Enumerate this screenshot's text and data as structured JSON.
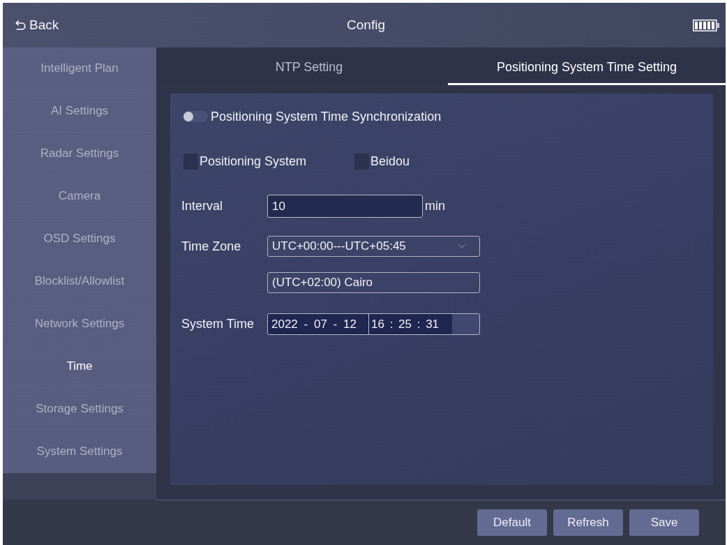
{
  "header": {
    "back_label": "Back",
    "title": "Config"
  },
  "sidebar": {
    "items": [
      {
        "label": "Intelligent Plan",
        "selected": false
      },
      {
        "label": "AI Settings",
        "selected": false
      },
      {
        "label": "Radar Settings",
        "selected": false
      },
      {
        "label": "Camera",
        "selected": false
      },
      {
        "label": "OSD Settings",
        "selected": false
      },
      {
        "label": "Blocklist/Allowlist",
        "selected": false
      },
      {
        "label": "Network Settings",
        "selected": false
      },
      {
        "label": "Time",
        "selected": true
      },
      {
        "label": "Storage Settings",
        "selected": false
      },
      {
        "label": "System Settings",
        "selected": false
      }
    ]
  },
  "tabs": [
    {
      "label": "NTP Setting",
      "selected": false
    },
    {
      "label": "Positioning System Time Setting",
      "selected": true
    }
  ],
  "form": {
    "sync_toggle": {
      "label": "Positioning System Time Synchronization",
      "on": false
    },
    "sources": [
      {
        "label": "Positioning System",
        "checked": false
      },
      {
        "label": "Beidou",
        "checked": false
      }
    ],
    "interval": {
      "label": "Interval",
      "value": "10",
      "unit": "min"
    },
    "time_zone": {
      "label": "Time Zone",
      "range": "UTC+00:00---UTC+05:45",
      "zone": "(UTC+02:00) Cairo"
    },
    "system_time": {
      "label": "System Time",
      "date": "2022 - 07 - 12",
      "time": "16 : 25 : 31"
    }
  },
  "buttons": [
    "Default",
    "Refresh",
    "Save"
  ]
}
